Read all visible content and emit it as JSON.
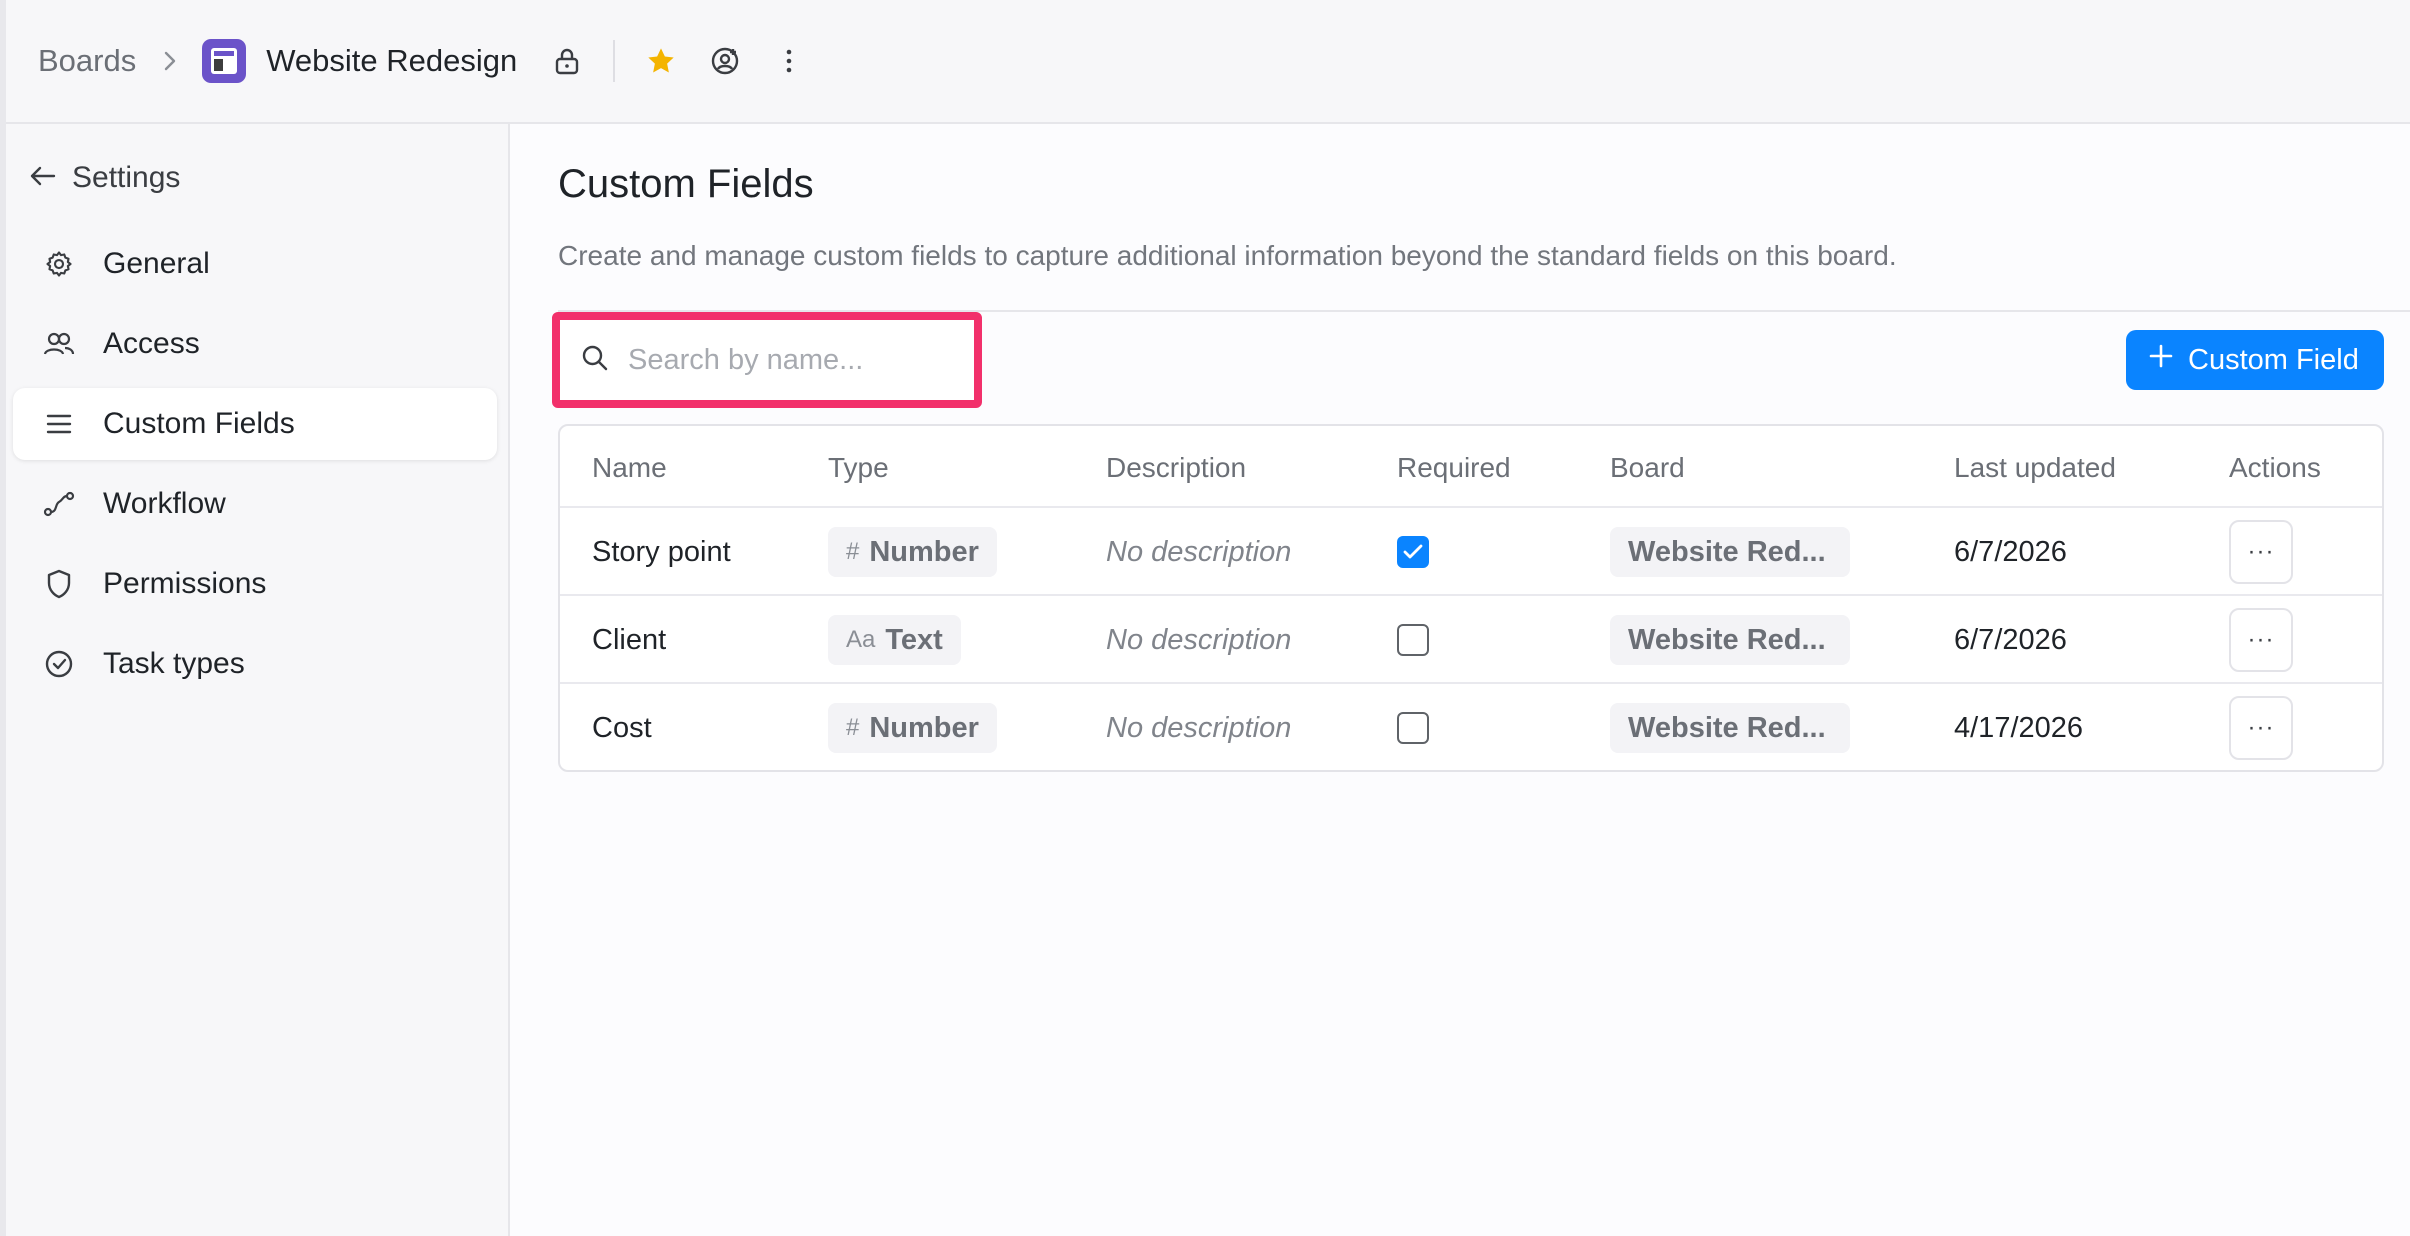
{
  "header": {
    "breadcrumb_root": "Boards",
    "board_title": "Website Redesign",
    "icons": [
      "chevron-right-icon",
      "board-logo-icon",
      "lock-icon",
      "star-icon",
      "user-add-icon",
      "more-vertical-icon"
    ],
    "accent_star": "#f4b400"
  },
  "sidebar": {
    "back_label": "Settings",
    "items": [
      {
        "label": "General",
        "icon": "gear-icon"
      },
      {
        "label": "Access",
        "icon": "users-icon"
      },
      {
        "label": "Custom Fields",
        "icon": "list-icon",
        "active": true
      },
      {
        "label": "Workflow",
        "icon": "workflow-icon"
      },
      {
        "label": "Permissions",
        "icon": "shield-icon"
      },
      {
        "label": "Task types",
        "icon": "check-circle-icon"
      }
    ]
  },
  "main": {
    "title": "Custom Fields",
    "description": "Create and manage custom fields to capture additional information beyond the standard fields on this board.",
    "search": {
      "placeholder": "Search by name...",
      "value": ""
    },
    "add_button_label": "Custom Field",
    "accent": "#0a84ff",
    "highlight_color": "#f2306b"
  },
  "table": {
    "headers": [
      "Name",
      "Type",
      "Description",
      "Required",
      "Board",
      "Last updated",
      "Actions"
    ],
    "rows": [
      {
        "name": "Story point",
        "type_glyph": "#",
        "type": "Number",
        "description": "No description",
        "required": true,
        "board": "Website Red...",
        "updated": "6/7/2026",
        "actions": "···"
      },
      {
        "name": "Client",
        "type_glyph": "Aa",
        "type": "Text",
        "description": "No description",
        "required": false,
        "board": "Website Red...",
        "updated": "6/7/2026",
        "actions": "···"
      },
      {
        "name": "Cost",
        "type_glyph": "#",
        "type": "Number",
        "description": "No description",
        "required": false,
        "board": "Website Red...",
        "updated": "4/17/2026",
        "actions": "···"
      }
    ]
  }
}
